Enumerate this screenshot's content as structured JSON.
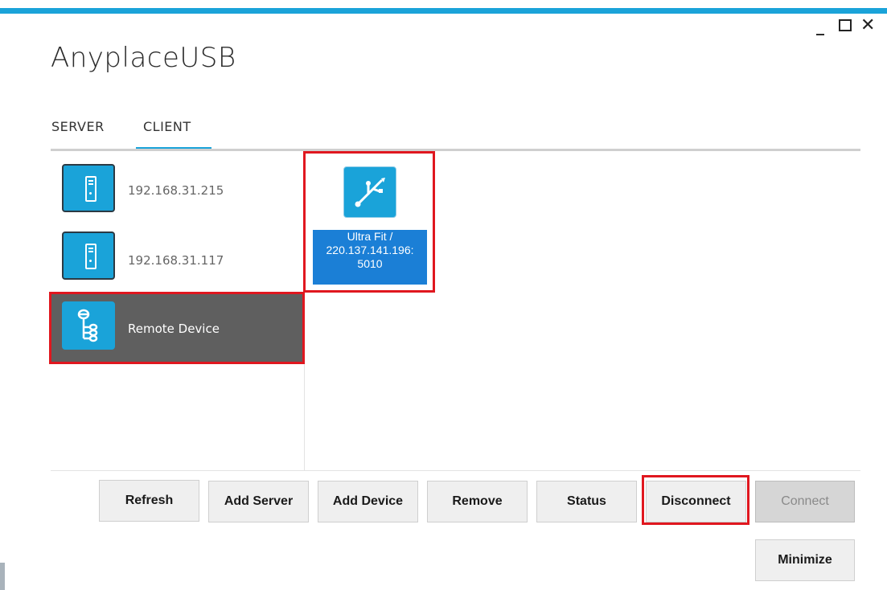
{
  "app": {
    "title": "AnyplaceUSB"
  },
  "window_controls": {
    "minimize": "_",
    "close": "✕"
  },
  "tabs": [
    {
      "label": "SERVER",
      "active": false
    },
    {
      "label": "CLIENT",
      "active": true
    }
  ],
  "servers": [
    {
      "label": "192.168.31.215",
      "icon": "server-icon"
    },
    {
      "label": "192.168.31.117",
      "icon": "server-icon"
    },
    {
      "label": "Remote Device",
      "icon": "remote-device-tree-icon",
      "selected": true
    }
  ],
  "devices": [
    {
      "line1": "Ultra Fit /",
      "line2": "220.137.141.196:",
      "line3": "5010",
      "icon": "usb-icon",
      "selected": true
    }
  ],
  "buttons": {
    "refresh": "Refresh",
    "add_server": "Add Server",
    "add_device": "Add Device",
    "remove": "Remove",
    "status": "Status",
    "disconnect": "Disconnect",
    "connect": "Connect",
    "minimize": "Minimize"
  },
  "colors": {
    "accent": "#1aa3d9",
    "selected_bg": "#5f5f5f",
    "highlight": "#e0171f",
    "device_label_bg": "#1b7fd6"
  }
}
